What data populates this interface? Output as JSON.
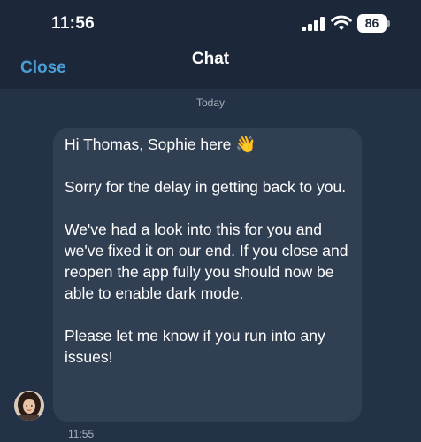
{
  "status_bar": {
    "time": "11:56",
    "battery_level": "86"
  },
  "header": {
    "close_label": "Close",
    "title": "Chat"
  },
  "date_separator": "Today",
  "message": {
    "greeting": "Hi Thomas, Sophie here",
    "wave_emoji": "👋",
    "paragraphs": [
      "Sorry for the delay in getting back to you.",
      "We've had a look into this for you and we've fixed it on our end. If you close and reopen the app fully you should now be able to enable dark mode.",
      "Please let me know if you run into any issues!"
    ],
    "time": "11:55"
  },
  "colors": {
    "background": "#233246",
    "header_background": "#1c283a",
    "bubble": "#313f53",
    "accent": "#4a9ed6",
    "muted_text": "#a7b0bd"
  },
  "icons": {
    "signal": "cellular-signal-icon",
    "wifi": "wifi-icon",
    "battery": "battery-icon"
  }
}
